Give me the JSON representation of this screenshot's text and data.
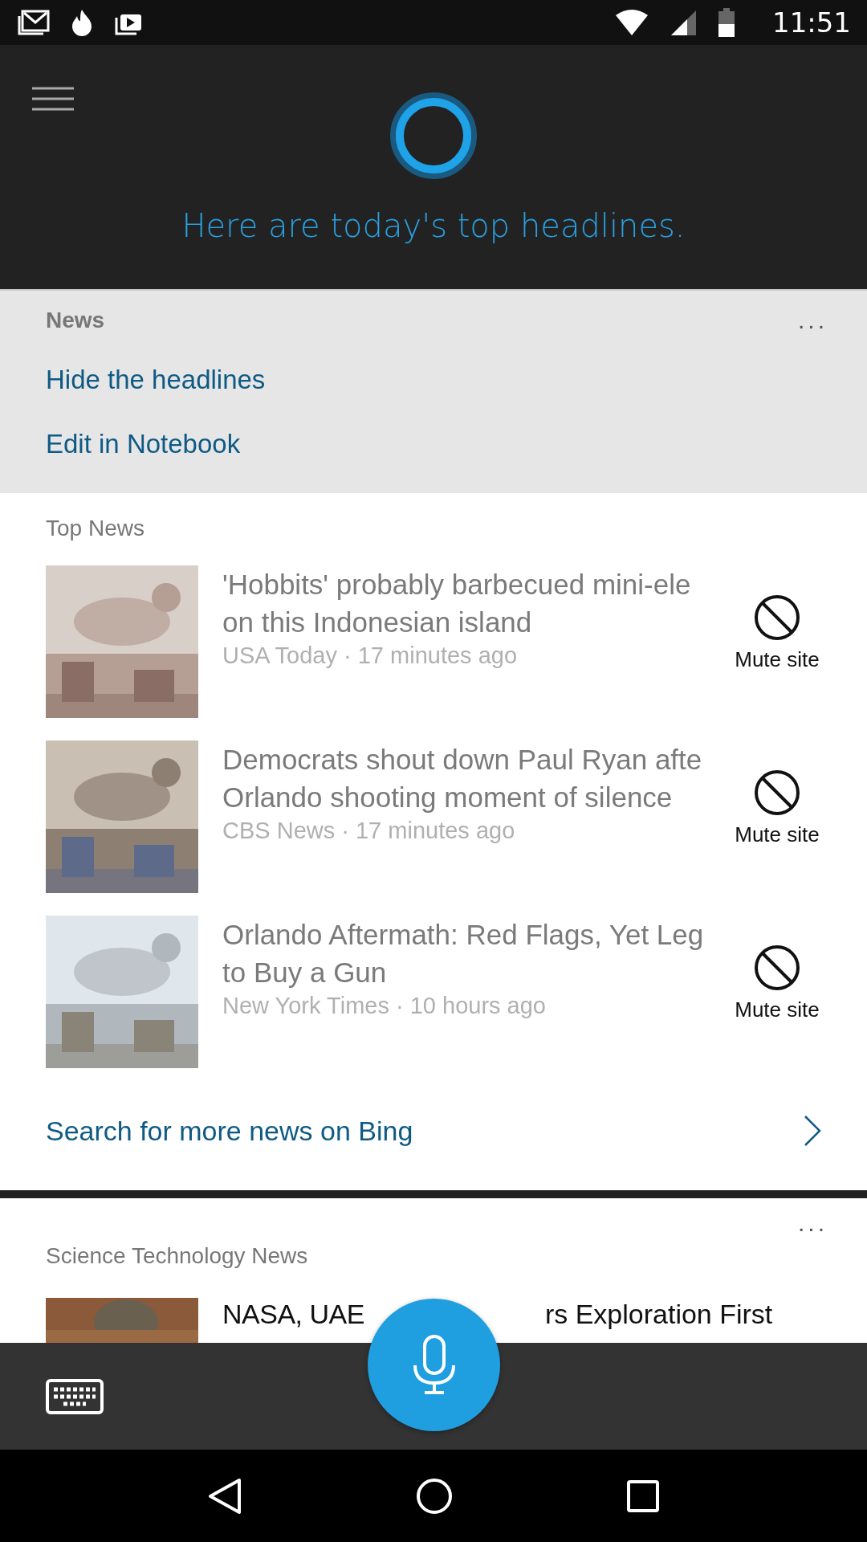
{
  "status_bar": {
    "time": "11:51"
  },
  "header": {
    "greeting": "Here are today's top headlines."
  },
  "news_panel": {
    "title": "News",
    "more": "...",
    "links": [
      "Hide the headlines",
      "Edit in Notebook"
    ]
  },
  "top_news": {
    "title": "Top News",
    "articles": [
      {
        "title_lines": [
          "'Hobbits' probably barbecued mini-ele",
          "on this Indonesian island"
        ],
        "source": "USA Today · 17 minutes ago",
        "action": "Mute site",
        "kind": "picture"
      },
      {
        "title_lines": [
          "Democrats shout down Paul Ryan afte",
          "Orlando shooting moment of silence"
        ],
        "source": "CBS News · 17 minutes ago",
        "action": "Mute site",
        "kind": "picture"
      },
      {
        "title_lines": [
          "Orlando Aftermath: Red Flags, Yet Leg",
          "to Buy a Gun"
        ],
        "source": "New York Times · 10 hours ago",
        "action": "Mute site",
        "kind": "picture"
      }
    ],
    "more_link": "Search for more news on Bing"
  },
  "science_news": {
    "more": "...",
    "title": "Science Technology News",
    "article_parts": [
      "NASA, UAE",
      "rs Exploration First"
    ]
  }
}
